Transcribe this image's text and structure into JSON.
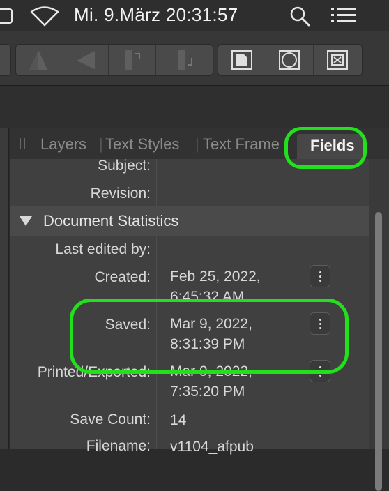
{
  "menubar": {
    "clock": "Mi. 9.März  20:31:57",
    "icons": [
      "battery-icon",
      "wifi-icon",
      "search-icon",
      "control-center-icon"
    ]
  },
  "toolbar": {
    "buttons": [
      "align-left-icon",
      "align-center-icon",
      "align-right-icon",
      "flow-in-icon",
      "flow-out-icon",
      "document-icon",
      "circle-icon",
      "delete-frame-icon"
    ]
  },
  "tabs": {
    "items": [
      "Layers",
      "Text Styles",
      "Text Frame"
    ],
    "separator": "|",
    "active": "Fields"
  },
  "fields": {
    "subject_label": "Subject:",
    "revision_label": "Revision:",
    "section_title": "Document Statistics",
    "last_edited_label": "Last edited by:",
    "created_label": "Created:",
    "created_line1": "Feb 25, 2022,",
    "created_line2": "6:45:32 AM",
    "saved_label": "Saved:",
    "saved_line1": "Mar 9, 2022,",
    "saved_line2": "8:31:39 PM",
    "printed_label": "Printed/Exported:",
    "printed_line1": "Mar 9, 2022,",
    "printed_line2": "7:35:20 PM",
    "save_count_label": "Save Count:",
    "save_count_value": "14",
    "filename_label": "Filename:",
    "filename_value": "v1104_afpub"
  },
  "colors": {
    "highlight": "#22e01c",
    "panel": "#404040",
    "background": "#2b2b2b"
  }
}
